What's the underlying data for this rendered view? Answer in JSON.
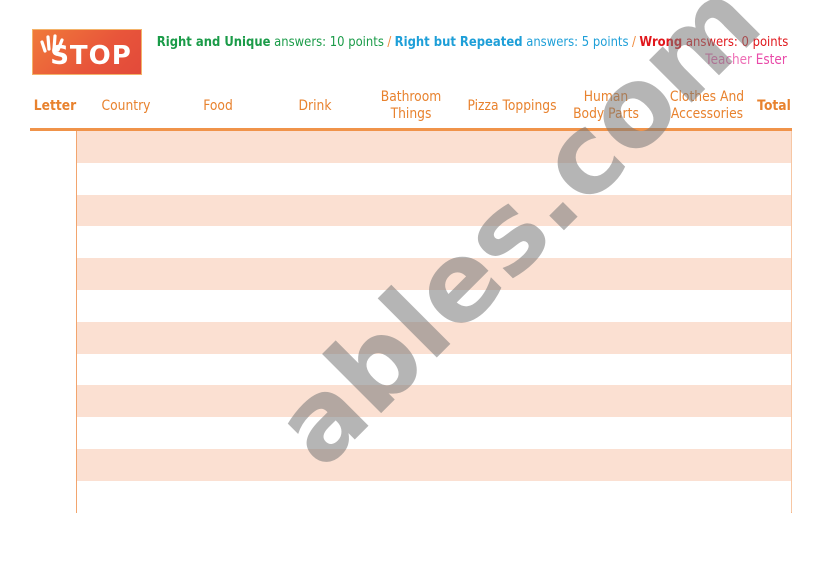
{
  "logo": {
    "text": "STOP",
    "icon": "hand-icon"
  },
  "rules": {
    "unique": {
      "label": "Right and Unique",
      "suffix": "answers: 10 points",
      "color": "#1a9b48"
    },
    "repeated": {
      "label": "Right but Repeated",
      "suffix": "answers: 5 points",
      "color": "#1e9fd8"
    },
    "wrong": {
      "label": "Wrong",
      "suffix": "answers: 0 points",
      "color": "#e0161b"
    },
    "separator": "/"
  },
  "author": {
    "prefix": "Teacher",
    "name": "Ester"
  },
  "columns": [
    {
      "label": "Letter"
    },
    {
      "label": "Country"
    },
    {
      "label": "Food"
    },
    {
      "label": "Drink"
    },
    {
      "label": "Bathroom Things"
    },
    {
      "label": "Pizza Toppings"
    },
    {
      "label": "Human Body Parts"
    },
    {
      "label": "Clothes And Accessories"
    },
    {
      "label": "Total"
    }
  ],
  "table": {
    "row_count": 12,
    "shade_color": "#fbe0d2",
    "accent_color": "#f0934a"
  },
  "watermark": "ables.com"
}
